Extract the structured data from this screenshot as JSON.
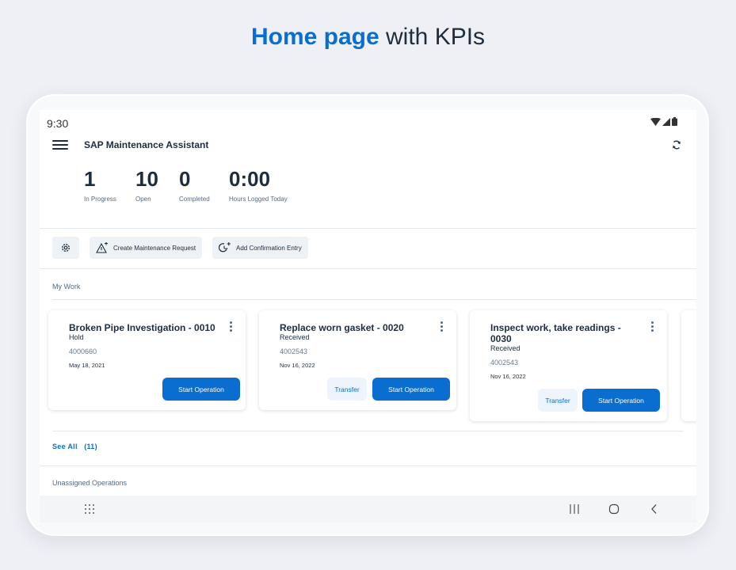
{
  "headline": {
    "accent": "Home page",
    "rest": " with KPIs"
  },
  "status_bar": {
    "time": "9:30",
    "icons": [
      "wifi-icon",
      "signal-icon",
      "battery-icon"
    ]
  },
  "app_bar": {
    "title": "SAP Maintenance Assistant",
    "menu_icon": "hamburger-icon",
    "sync_icon": "sync-icon"
  },
  "kpis": [
    {
      "value": "1",
      "label": "In Progress"
    },
    {
      "value": "10",
      "label": "Open"
    },
    {
      "value": "0",
      "label": "Completed"
    },
    {
      "value": "0:00",
      "label": "Hours Logged Today"
    }
  ],
  "actions": {
    "settings_icon": "settings-gear-icon",
    "create_request": "Create Maintenance Request",
    "add_confirmation": "Add Confirmation Entry"
  },
  "my_work": {
    "label": "My Work",
    "cards": [
      {
        "title": "Broken Pipe Investigation - 0010",
        "status": "Hold",
        "order": "4000660",
        "date": "May 18, 2021",
        "start": "Start Operation"
      },
      {
        "title": "Replace worn gasket - 0020",
        "status": "Received",
        "order": "4002543",
        "date": "Nov 16, 2022",
        "transfer": "Transfer",
        "start": "Start Operation"
      },
      {
        "title": "Inspect work, take readings - 0030",
        "status": "Received",
        "order": "4002543",
        "date": "Nov 16, 2022",
        "transfer": "Transfer",
        "start": "Start Operation"
      }
    ],
    "see_all": "See All",
    "count": "(11)"
  },
  "unassigned": {
    "label": "Unassigned Operations"
  },
  "colors": {
    "accent": "#0a6ed1",
    "text": "#1d2d3e",
    "muted": "#556b82"
  }
}
